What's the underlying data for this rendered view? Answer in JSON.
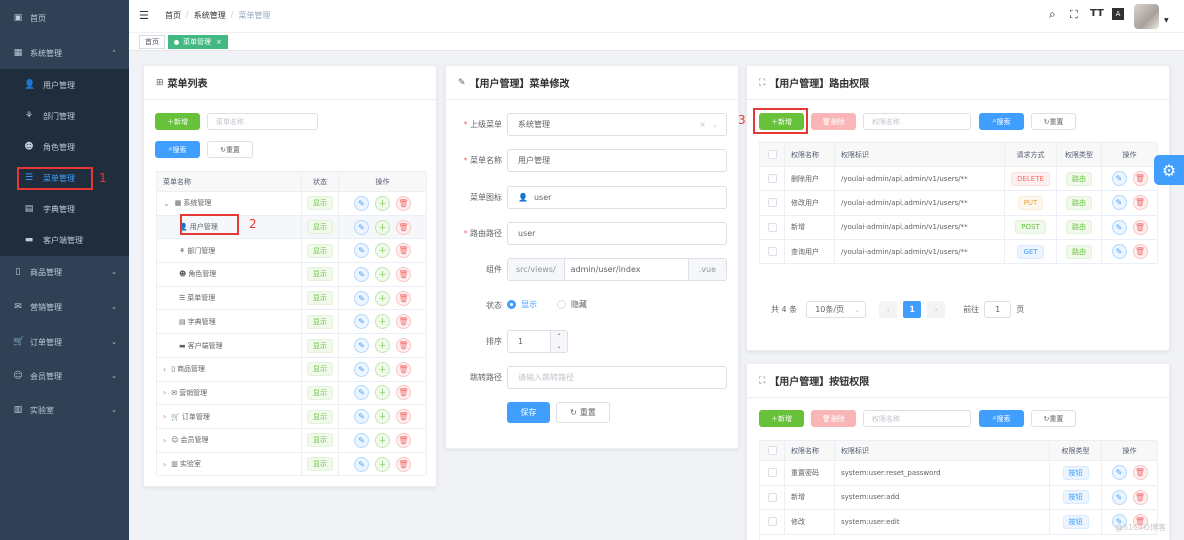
{
  "sidebar": {
    "items": [
      {
        "icon": "dashboard-icon",
        "label": "首页"
      },
      {
        "icon": "grid-icon",
        "label": "系统管理"
      },
      {
        "icon": "user-icon",
        "label": "用户管理"
      },
      {
        "icon": "org-tree-icon",
        "label": "部门管理"
      },
      {
        "icon": "role-icon",
        "label": "角色管理"
      },
      {
        "icon": "menu-tree-icon",
        "label": "菜单管理"
      },
      {
        "icon": "dict-icon",
        "label": "字典管理"
      },
      {
        "icon": "client-icon",
        "label": "客户端管理"
      },
      {
        "icon": "phone-icon",
        "label": "商品管理"
      },
      {
        "icon": "marketing-icon",
        "label": "营销管理"
      },
      {
        "icon": "cart-icon",
        "label": "订单管理"
      },
      {
        "icon": "member-icon",
        "label": "会员管理"
      },
      {
        "icon": "lab-icon",
        "label": "实验室"
      }
    ],
    "annotation": "1"
  },
  "topbar": {
    "breadcrumb": [
      "首页",
      "系统管理",
      "菜单管理"
    ],
    "separator": "/"
  },
  "tags": {
    "home": "首页",
    "active": "菜单管理",
    "close": "×"
  },
  "menu_list": {
    "title": "菜单列表",
    "add_label": "新增",
    "name_placeholder": "菜单名称",
    "search_label": "搜索",
    "reset_label": "重置",
    "columns": [
      "菜单名称",
      "状态",
      "操作"
    ],
    "status_text": "显示",
    "rows": [
      {
        "name": "系统管理",
        "expand": "⌄"
      },
      {
        "name": "用户管理",
        "expand": ""
      },
      {
        "name": "部门管理",
        "expand": ""
      },
      {
        "name": "角色管理",
        "expand": ""
      },
      {
        "name": "菜单管理",
        "expand": ""
      },
      {
        "name": "字典管理",
        "expand": ""
      },
      {
        "name": "客户端管理",
        "expand": ""
      },
      {
        "name": "商品管理",
        "expand": "›"
      },
      {
        "name": "营销管理",
        "expand": "›"
      },
      {
        "name": "订单管理",
        "expand": "›"
      },
      {
        "name": "会员管理",
        "expand": "›"
      },
      {
        "name": "实验室",
        "expand": "›"
      }
    ],
    "annotation": "2"
  },
  "menu_edit": {
    "title": "【用户管理】菜单修改",
    "parent_label": "上级菜单",
    "parent_value": "系统管理",
    "name_label": "菜单名称",
    "name_value": "用户管理",
    "icon_label": "菜单图标",
    "icon_value": "user",
    "route_label": "路由路径",
    "route_value": "user",
    "component_label": "组件",
    "component_prefix": "src/views/",
    "component_value": "admin/user/index",
    "component_suffix": ".vue",
    "status_label": "状态",
    "status_show": "显示",
    "status_hide": "隐藏",
    "sort_label": "排序",
    "sort_value": "1",
    "redirect_label": "跳转路径",
    "redirect_placeholder": "请输入跳转路径",
    "save_label": "保存",
    "reset_label": "重置"
  },
  "route_perm": {
    "title": "【用户管理】路由权限",
    "add_label": "新增",
    "delete_label": "删除",
    "name_placeholder": "权限名称",
    "search_label": "搜索",
    "reset_label": "重置",
    "columns": [
      "权限名称",
      "权限标识",
      "请求方式",
      "权限类型",
      "操作"
    ],
    "rows": [
      {
        "name": "删除用户",
        "ident": "/youlai-admin/api.admin/v1/users/**",
        "method": "DELETE",
        "method_color": "red",
        "type": "路由"
      },
      {
        "name": "修改用户",
        "ident": "/youlai-admin/api.admin/v1/users/**",
        "method": "PUT",
        "method_color": "yellow",
        "type": "路由"
      },
      {
        "name": "新增",
        "ident": "/youlai-admin/api.admin/v1/users/**",
        "method": "POST",
        "method_color": "green",
        "type": "路由"
      },
      {
        "name": "查询用户",
        "ident": "/youlai-admin/api.admin/v1/users/**",
        "method": "GET",
        "method_color": "blue",
        "type": "路由"
      }
    ],
    "pagination": {
      "total": "共 4 条",
      "page_size": "10条/页",
      "prev": "‹",
      "page": "1",
      "next": "›",
      "goto_label": "前往",
      "goto_value": "1",
      "page_unit": "页"
    },
    "annotation": "3"
  },
  "button_perm": {
    "title": "【用户管理】按钮权限",
    "add_label": "新增",
    "delete_label": "删除",
    "name_placeholder": "权限名称",
    "search_label": "搜索",
    "reset_label": "重置",
    "columns": [
      "权限名称",
      "权限标识",
      "权限类型",
      "操作"
    ],
    "rows": [
      {
        "name": "重置密码",
        "ident": "system:user:reset_password",
        "type": "按钮"
      },
      {
        "name": "新增",
        "ident": "system:user:add",
        "type": "按钮"
      },
      {
        "name": "修改",
        "ident": "system:user:edit",
        "type": "按钮"
      }
    ]
  },
  "watermark": "@51CTO博客",
  "colors": {
    "accent": "#409eff",
    "success": "#67c23a",
    "danger": "#f56c6c",
    "sidebar": "#304156",
    "tag_active": "#42b983",
    "annotation": "#e53935"
  }
}
